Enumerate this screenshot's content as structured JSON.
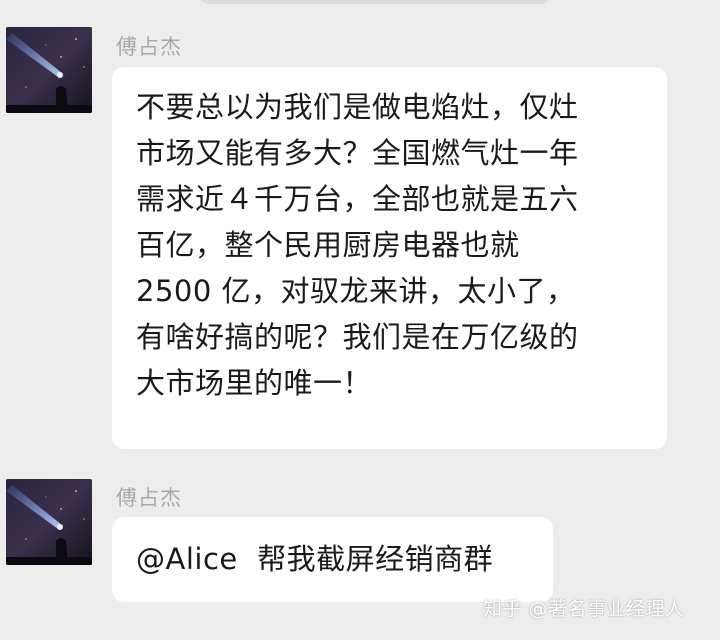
{
  "messages": [
    {
      "sender": "傅占杰",
      "lines": [
        "不要总以为我们是做电焰灶，仅灶",
        "市场又能有多大？全国燃气灶一年",
        "需求近４千万台，全部也就是五六",
        "百亿，整个民用厨房电器也就",
        "2500 亿，对驭龙来讲，太小了，",
        "有啥好搞的呢？我们是在万亿级的",
        "大市场里的唯一！"
      ]
    },
    {
      "sender": "傅占杰",
      "text": "@Alice  帮我截屏经销商群"
    }
  ],
  "watermark": "知乎 @著名事业经理人",
  "colors": {
    "background": "#ededed",
    "bubble": "#ffffff",
    "sender_name": "#a8a8a8",
    "message_text": "#1a1a1a"
  }
}
